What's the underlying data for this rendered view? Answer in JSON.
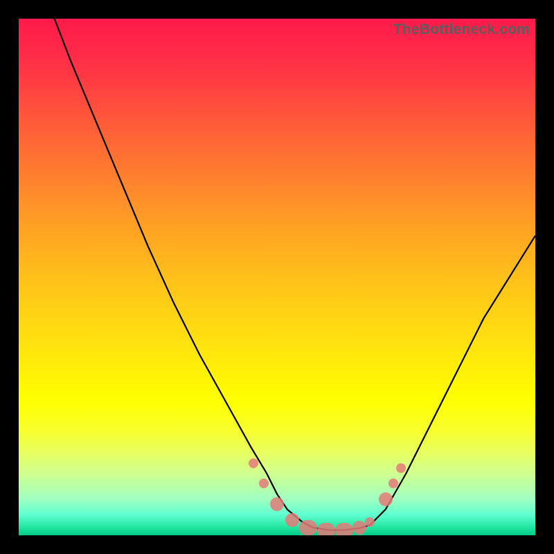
{
  "watermark": "TheBottleneck.com",
  "colors": {
    "frame": "#000000",
    "curve_stroke": "#000000",
    "marker_fill": "#e47a78"
  },
  "chart_data": {
    "type": "line",
    "title": "",
    "xlabel": "",
    "ylabel": "",
    "xlim": [
      0,
      100
    ],
    "ylim": [
      0,
      100
    ],
    "grid": false,
    "legend": false,
    "series": [
      {
        "name": "curve",
        "x": [
          5,
          10,
          15,
          20,
          25,
          30,
          35,
          40,
          45,
          48,
          50,
          52,
          55,
          57,
          60,
          63,
          66,
          68,
          71,
          75,
          80,
          85,
          90,
          95,
          100
        ],
        "y": [
          105,
          92,
          80,
          68,
          56,
          45,
          35,
          26,
          17,
          12,
          8,
          5,
          2.5,
          1.5,
          1,
          1,
          1.4,
          2,
          5,
          12,
          22,
          32,
          42,
          50,
          58
        ]
      }
    ],
    "markers": [
      {
        "x": 45.5,
        "y": 14,
        "size": "small"
      },
      {
        "x": 47.5,
        "y": 10,
        "size": "small"
      },
      {
        "x": 50,
        "y": 6,
        "size": "normal"
      },
      {
        "x": 53,
        "y": 3,
        "size": "normal"
      },
      {
        "x": 56,
        "y": 1.5,
        "size": "big"
      },
      {
        "x": 59.5,
        "y": 1,
        "size": "big"
      },
      {
        "x": 63,
        "y": 1,
        "size": "big"
      },
      {
        "x": 66,
        "y": 1.5,
        "size": "normal"
      },
      {
        "x": 68,
        "y": 2.5,
        "size": "small"
      },
      {
        "x": 71,
        "y": 7,
        "size": "normal"
      },
      {
        "x": 72.5,
        "y": 10,
        "size": "small"
      },
      {
        "x": 74,
        "y": 13,
        "size": "small"
      }
    ]
  }
}
